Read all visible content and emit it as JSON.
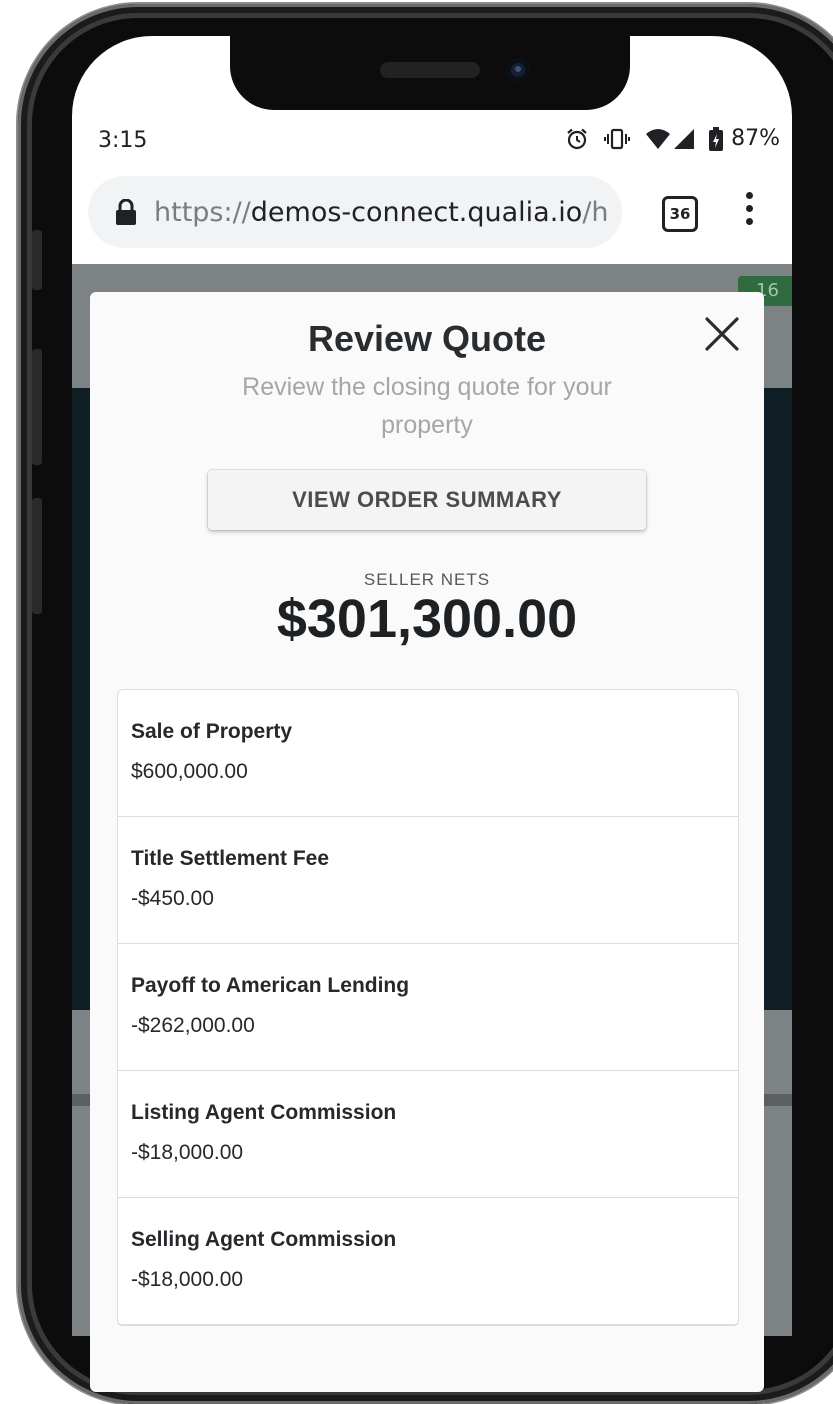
{
  "status_bar": {
    "time": "3:15",
    "battery": "87%",
    "icons": [
      "alarm-icon",
      "vibrate-icon",
      "wifi-icon",
      "signal-icon",
      "battery-charging-icon"
    ]
  },
  "browser": {
    "url_scheme": "https://",
    "url_host": "demos-connect.qualia.io",
    "url_rest": "/h",
    "tab_count": "36"
  },
  "background_page": {
    "badge": "16"
  },
  "modal": {
    "title": "Review Quote",
    "subtitle": "Review the closing quote for your property",
    "order_summary_button": "VIEW ORDER SUMMARY",
    "nets_label": "SELLER NETS",
    "nets_value": "$301,300.00",
    "items": [
      {
        "label": "Sale of Property",
        "value": "$600,000.00"
      },
      {
        "label": "Title Settlement Fee",
        "value": "-$450.00"
      },
      {
        "label": "Payoff to American Lending",
        "value": "-$262,000.00"
      },
      {
        "label": "Listing Agent Commission",
        "value": "-$18,000.00"
      },
      {
        "label": "Selling Agent Commission",
        "value": "-$18,000.00"
      }
    ]
  }
}
